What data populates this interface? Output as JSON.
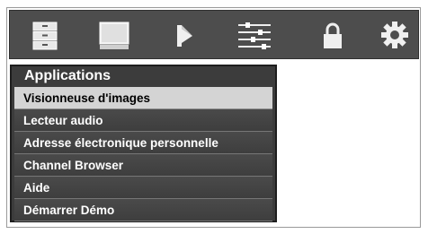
{
  "toolbar": {
    "icons": [
      {
        "name": "list-icon"
      },
      {
        "name": "monitor-icon"
      },
      {
        "name": "speaker-icon"
      },
      {
        "name": "sliders-icon"
      },
      {
        "name": "lock-icon"
      },
      {
        "name": "gear-icon"
      }
    ]
  },
  "menu": {
    "title": "Applications",
    "items": [
      {
        "label": "Visionneuse d'images",
        "selected": true
      },
      {
        "label": "Lecteur audio",
        "selected": false
      },
      {
        "label": "Adresse électronique personnelle",
        "selected": false
      },
      {
        "label": "Channel Browser",
        "selected": false
      },
      {
        "label": "Aide",
        "selected": false
      },
      {
        "label": "Démarrer Démo",
        "selected": false
      }
    ]
  },
  "colors": {
    "bar_bg": "#4d4d4d",
    "menu_bg": "#3c3c3c",
    "selected_bg": "#d4d4d4",
    "text": "#ffffff"
  }
}
